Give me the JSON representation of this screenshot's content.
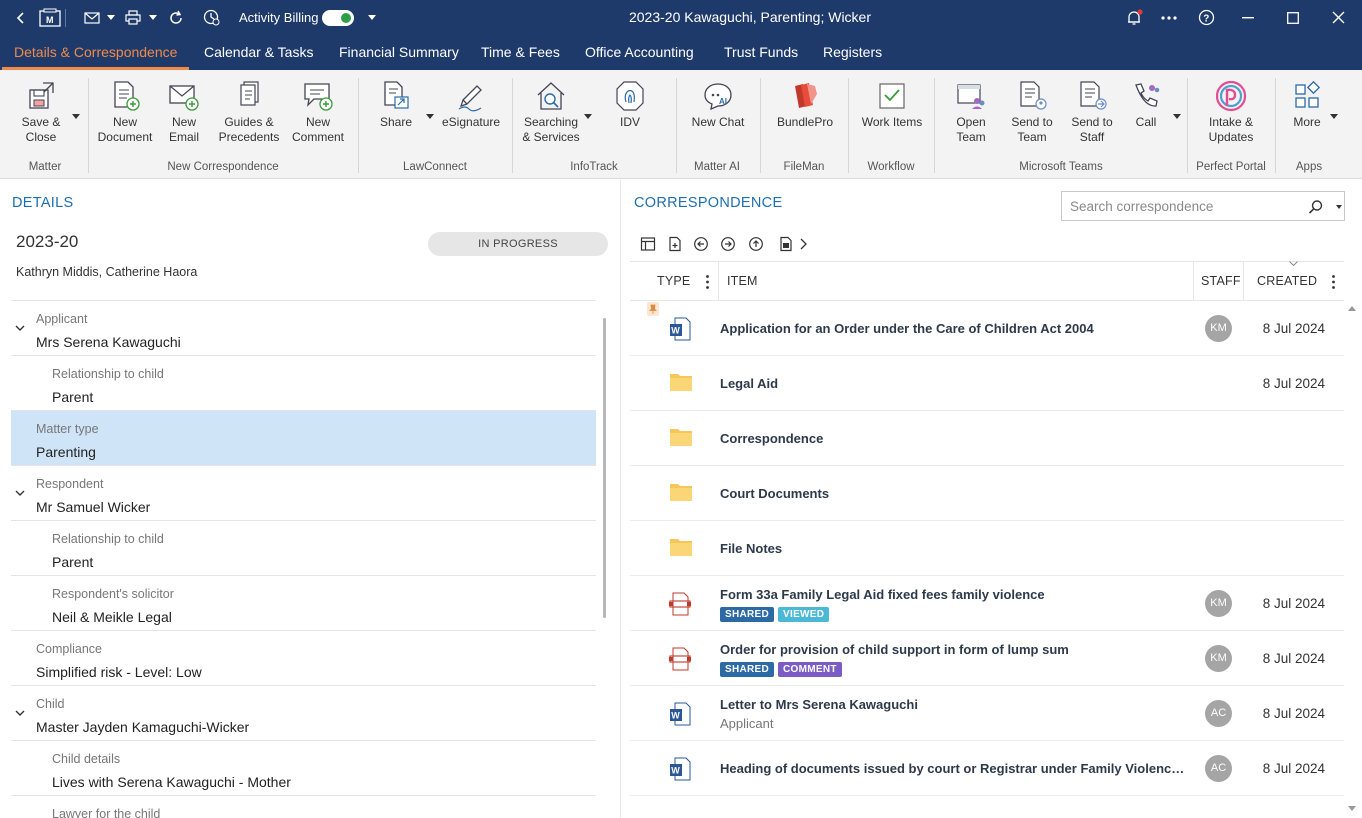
{
  "titlebar": {
    "window_title": "2023-20 Kawaguchi, Parenting; Wicker",
    "activity_billing_label": "Activity Billing",
    "activity_billing_on": true,
    "icons": [
      "back-arrow-icon",
      "matter-icon",
      "email-icon",
      "print-icon",
      "refresh-icon",
      "clock-icon",
      "notification-bell-icon",
      "more-options-icon",
      "help-icon",
      "minimize-icon",
      "maximize-icon",
      "close-icon"
    ]
  },
  "nav": {
    "tabs": [
      {
        "label": "Details & Correspondence",
        "active": true
      },
      {
        "label": "Calendar & Tasks"
      },
      {
        "label": "Financial Summary"
      },
      {
        "label": "Time & Fees"
      },
      {
        "label": "Office Accounting"
      },
      {
        "label": "Trust Funds"
      },
      {
        "label": "Registers"
      }
    ]
  },
  "ribbon": {
    "buttons": [
      {
        "line1": "Save &",
        "line2": "Close"
      },
      {
        "line1": "New",
        "line2": "Document"
      },
      {
        "line1": "New",
        "line2": "Email"
      },
      {
        "line1": "Guides &",
        "line2": "Precedents"
      },
      {
        "line1": "New",
        "line2": "Comment"
      },
      {
        "line1": "Share",
        "line2": ""
      },
      {
        "line1": "eSignature",
        "line2": ""
      },
      {
        "line1": "Searching",
        "line2": "& Services"
      },
      {
        "line1": "IDV",
        "line2": ""
      },
      {
        "line1": "New Chat",
        "line2": ""
      },
      {
        "line1": "BundlePro",
        "line2": ""
      },
      {
        "line1": "Work Items",
        "line2": ""
      },
      {
        "line1": "Open",
        "line2": "Team"
      },
      {
        "line1": "Send to",
        "line2": "Team"
      },
      {
        "line1": "Send to",
        "line2": "Staff"
      },
      {
        "line1": "Call",
        "line2": ""
      },
      {
        "line1": "Intake &",
        "line2": "Updates"
      },
      {
        "line1": "More",
        "line2": ""
      }
    ],
    "groups": [
      "Matter",
      "New Correspondence",
      "LawConnect",
      "InfoTrack",
      "Matter AI",
      "FileMan",
      "Workflow",
      "Microsoft Teams",
      "Perfect Portal",
      "Apps"
    ]
  },
  "details": {
    "heading": "DETAILS",
    "matter_number": "2023-20",
    "status": "IN PROGRESS",
    "people": "Kathryn Middis, Catherine Haora",
    "rows": [
      {
        "label": "Applicant",
        "value": "Mrs Serena Kawaguchi"
      },
      {
        "label": "Relationship to child",
        "value": "Parent"
      },
      {
        "label": "Matter type",
        "value": "Parenting"
      },
      {
        "label": "Respondent",
        "value": "Mr Samuel Wicker"
      },
      {
        "label": "Relationship to child",
        "value": "Parent"
      },
      {
        "label": "Respondent's solicitor",
        "value": "Neil & Meikle Legal"
      },
      {
        "label": "Compliance",
        "value": "Simplified risk - Level: Low"
      },
      {
        "label": "Child",
        "value": "Master Jayden Kamaguchi-Wicker"
      },
      {
        "label": "Child details",
        "value": "Lives with Serena Kawaguchi - Mother"
      },
      {
        "label": "Lawyer for the child",
        "value": ""
      }
    ]
  },
  "correspondence": {
    "heading": "CORRESPONDENCE",
    "search_placeholder": "Search correspondence",
    "columns": {
      "type": "TYPE",
      "item": "ITEM",
      "staff": "STAFF",
      "created": "CREATED"
    },
    "rows": [
      {
        "type": "word",
        "title": "Application for an Order under the Care of Children Act 2004",
        "staff": "KM",
        "created": "8 Jul 2024",
        "pinned": true
      },
      {
        "type": "folder",
        "title": "Legal Aid",
        "staff": "",
        "created": "8 Jul 2024"
      },
      {
        "type": "folder",
        "title": "Correspondence",
        "staff": "",
        "created": ""
      },
      {
        "type": "folder",
        "title": "Court Documents",
        "staff": "",
        "created": ""
      },
      {
        "type": "folder",
        "title": "File Notes",
        "staff": "",
        "created": ""
      },
      {
        "type": "form",
        "title": "Form 33a Family Legal Aid fixed fees family violence",
        "badges": [
          "SHARED",
          "VIEWED"
        ],
        "staff": "KM",
        "created": "8 Jul 2024"
      },
      {
        "type": "form",
        "title": "Order for provision of child support in form of lump sum",
        "badges": [
          "SHARED",
          "COMMENT"
        ],
        "staff": "KM",
        "created": "8 Jul 2024"
      },
      {
        "type": "word",
        "title": "Letter to Mrs Serena Kawaguchi",
        "subtitle": "Applicant",
        "staff": "AC",
        "created": "8 Jul 2024"
      },
      {
        "type": "word",
        "title": "Heading of documents issued by court or Registrar under Family Violence Act...",
        "staff": "AC",
        "created": "8 Jul 2024"
      }
    ]
  },
  "colors": {
    "navy": "#1e3a6a",
    "accent_orange": "#f08a4b",
    "link_blue": "#1f6fb0",
    "selected_row": "#cfe4f7",
    "badge_shared": "#2c6aa6",
    "badge_viewed": "#4bb8d6",
    "badge_comment": "#7b5cc4"
  }
}
